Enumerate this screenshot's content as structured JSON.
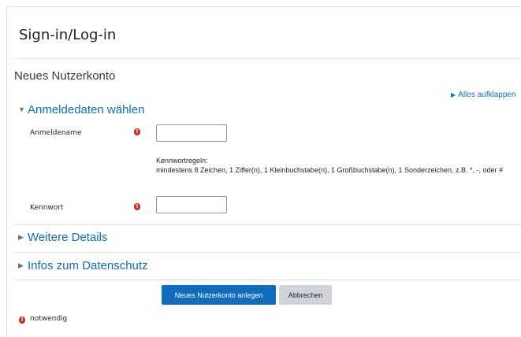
{
  "header": {
    "site_title": "Sign-in/Log-in"
  },
  "page": {
    "heading": "Neues Nutzerkonto",
    "expand_all": "Alles aufklappen"
  },
  "sections": {
    "credentials": {
      "title": "Anmeldedaten wählen",
      "expanded": true
    },
    "more_details": {
      "title": "Weitere Details",
      "expanded": false
    },
    "privacy": {
      "title": "Infos zum Datenschutz",
      "expanded": false
    }
  },
  "fields": {
    "username": {
      "label": "Anmeldename",
      "value": "",
      "required": true
    },
    "password": {
      "label": "Kennwort",
      "value": "",
      "required": true
    }
  },
  "password_rules": {
    "title": "Kennwortregeln:",
    "text": "mindestens 8 Zeichen, 1 Ziffer(n), 1 Kleinbuchstabe(n), 1 Großbuchstabe(n), 1 Sonderzeichen, z.B. *, -, oder #"
  },
  "buttons": {
    "submit": "Neues Nutzerkonto anlegen",
    "cancel": "Abbrechen"
  },
  "footer": {
    "required_note": "notwendig"
  },
  "icons": {
    "required": "exclamation-circle-icon",
    "expanded": "caret-down-icon",
    "collapsed": "caret-right-icon"
  },
  "colors": {
    "link": "#0f6cbf",
    "primary_button": "#0f6cbf",
    "secondary_button": "#ced4da",
    "required": "#ca3120"
  }
}
